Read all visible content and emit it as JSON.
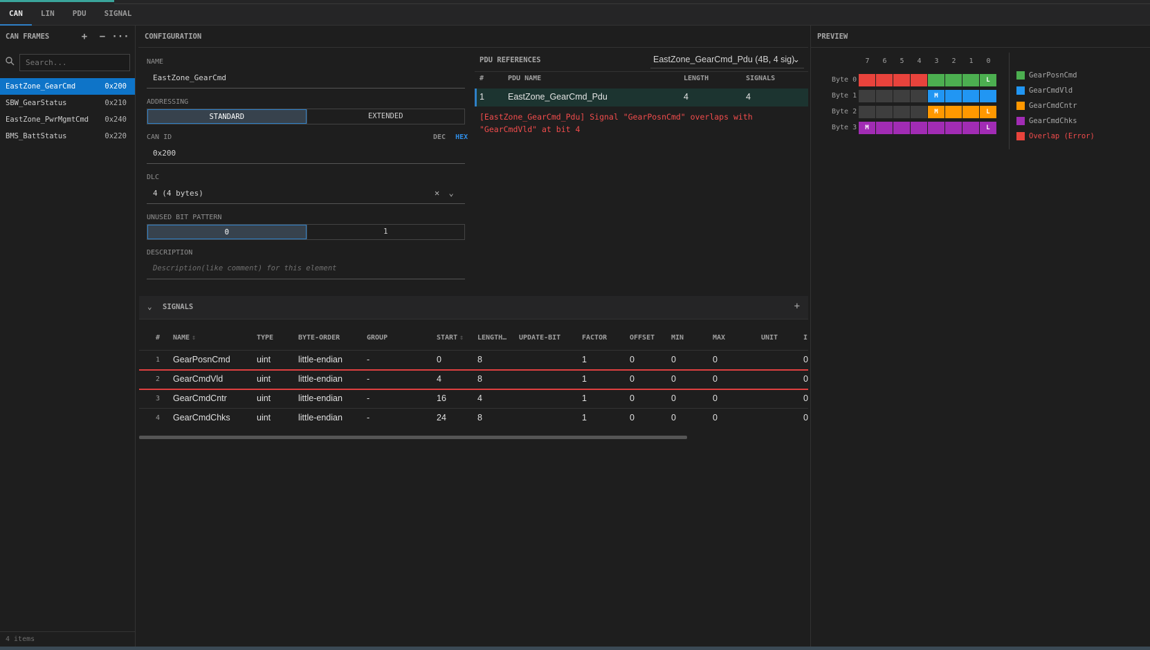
{
  "tabs": [
    "CAN",
    "LIN",
    "PDU",
    "SIGNAL"
  ],
  "sidebar": {
    "title": "CAN FRAMES",
    "add": "+",
    "remove": "−",
    "more": "···",
    "search_placeholder": "Search...",
    "search_icon": "search-icon",
    "frames": [
      {
        "name": "EastZone_GearCmd",
        "id": "0x200",
        "selected": true
      },
      {
        "name": "SBW_GearStatus",
        "id": "0x210",
        "selected": false
      },
      {
        "name": "EastZone_PwrMgmtCmd",
        "id": "0x240",
        "selected": false
      },
      {
        "name": "BMS_BattStatus",
        "id": "0x220",
        "selected": false
      }
    ],
    "footer": "4 items"
  },
  "config": {
    "title": "CONFIGURATION",
    "name_label": "NAME",
    "name_value": "EastZone_GearCmd",
    "addressing_label": "ADDRESSING",
    "addressing_options": [
      "STANDARD",
      "EXTENDED"
    ],
    "addressing_selected": "STANDARD",
    "canid_label": "CAN ID",
    "dec": "DEC",
    "hex": "HEX",
    "canid_value": "0x200",
    "dlc_label": "DLC",
    "dlc_value": "4 (4 bytes)",
    "unused_label": "UNUSED BIT PATTERN",
    "unused_options": [
      "0",
      "1"
    ],
    "unused_selected": "0",
    "desc_label": "DESCRIPTION",
    "desc_placeholder": "Description(like comment) for this element"
  },
  "pdu": {
    "title": "PDU REFERENCES",
    "selected": "EastZone_GearCmd_Pdu (4B, 4 sig)",
    "headers": [
      "#",
      "PDU NAME",
      "LENGTH",
      "SIGNALS"
    ],
    "rows": [
      {
        "idx": "1",
        "name": "EastZone_GearCmd_Pdu",
        "length": "4",
        "signals": "4"
      }
    ],
    "error": "[EastZone_GearCmd_Pdu] Signal \"GearPosnCmd\" overlaps with \"GearCmdVld\" at bit 4"
  },
  "signals": {
    "title": "SIGNALS",
    "add": "+",
    "headers": [
      "#",
      "NAME",
      "TYPE",
      "BYTE-ORDER",
      "GROUP",
      "START",
      "LENGTH…",
      "UPDATE-BIT",
      "FACTOR",
      "OFFSET",
      "MIN",
      "MAX",
      "UNIT",
      "I"
    ],
    "sort_glyph": "⇕",
    "rows": [
      {
        "idx": "1",
        "name": "GearPosnCmd",
        "type": "uint",
        "order": "little-endian",
        "group": "-",
        "start": "0",
        "length": "8",
        "update": "",
        "factor": "1",
        "offset": "0",
        "min": "0",
        "max": "0",
        "unit": "",
        "extra": "0"
      },
      {
        "idx": "2",
        "name": "GearCmdVld",
        "type": "uint",
        "order": "little-endian",
        "group": "-",
        "start": "4",
        "length": "8",
        "update": "",
        "factor": "1",
        "offset": "0",
        "min": "0",
        "max": "0",
        "unit": "",
        "extra": "0"
      },
      {
        "idx": "3",
        "name": "GearCmdCntr",
        "type": "uint",
        "order": "little-endian",
        "group": "-",
        "start": "16",
        "length": "4",
        "update": "",
        "factor": "1",
        "offset": "0",
        "min": "0",
        "max": "0",
        "unit": "",
        "extra": "0"
      },
      {
        "idx": "4",
        "name": "GearCmdChks",
        "type": "uint",
        "order": "little-endian",
        "group": "-",
        "start": "24",
        "length": "8",
        "update": "",
        "factor": "1",
        "offset": "0",
        "min": "0",
        "max": "0",
        "unit": "",
        "extra": "0"
      }
    ]
  },
  "preview": {
    "title": "PREVIEW",
    "bits": [
      "7",
      "6",
      "5",
      "4",
      "3",
      "2",
      "1",
      "0"
    ],
    "bytes": [
      {
        "label": "Byte 0",
        "cells": [
          [
            "err",
            ""
          ],
          [
            "err",
            ""
          ],
          [
            "err",
            ""
          ],
          [
            "err",
            ""
          ],
          [
            "g",
            ""
          ],
          [
            "g",
            ""
          ],
          [
            "g",
            ""
          ],
          [
            "g",
            "L"
          ]
        ]
      },
      {
        "label": "Byte 1",
        "cells": [
          [
            "e",
            ""
          ],
          [
            "e",
            ""
          ],
          [
            "e",
            ""
          ],
          [
            "e",
            ""
          ],
          [
            "b",
            "M"
          ],
          [
            "b",
            ""
          ],
          [
            "b",
            ""
          ],
          [
            "b",
            ""
          ]
        ]
      },
      {
        "label": "Byte 2",
        "cells": [
          [
            "e",
            ""
          ],
          [
            "e",
            ""
          ],
          [
            "e",
            ""
          ],
          [
            "e",
            ""
          ],
          [
            "o",
            "M"
          ],
          [
            "o",
            ""
          ],
          [
            "o",
            ""
          ],
          [
            "o",
            "L"
          ]
        ]
      },
      {
        "label": "Byte 3",
        "cells": [
          [
            "p",
            "M"
          ],
          [
            "p",
            ""
          ],
          [
            "p",
            ""
          ],
          [
            "p",
            ""
          ],
          [
            "p",
            ""
          ],
          [
            "p",
            ""
          ],
          [
            "p",
            ""
          ],
          [
            "p",
            "L"
          ]
        ]
      }
    ],
    "legend": [
      {
        "name": "GearPosnCmd",
        "color": "#4caf50"
      },
      {
        "name": "GearCmdVld",
        "color": "#2196f3"
      },
      {
        "name": "GearCmdCntr",
        "color": "#ff9800"
      },
      {
        "name": "GearCmdChks",
        "color": "#a12cb4"
      },
      {
        "name": "Overlap (Error)",
        "color": "#e8433c"
      }
    ]
  }
}
